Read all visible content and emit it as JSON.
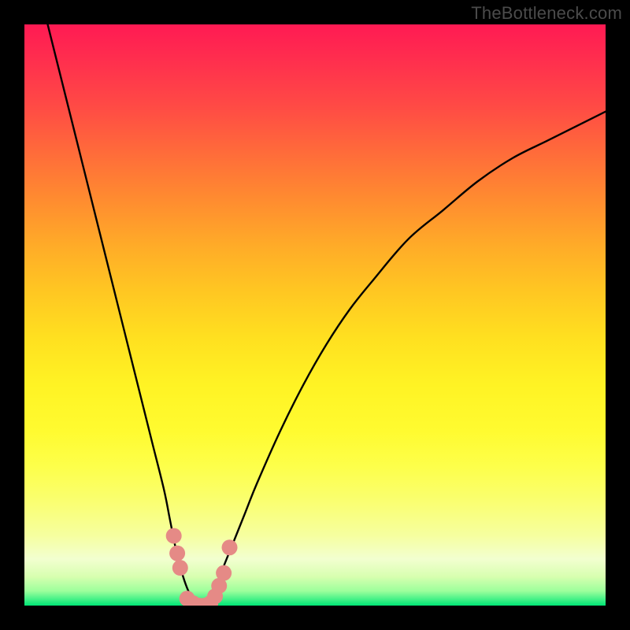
{
  "attribution": "TheBottleneck.com",
  "chart_data": {
    "type": "line",
    "title": "",
    "xlabel": "",
    "ylabel": "",
    "xlim": [
      0,
      100
    ],
    "ylim": [
      0,
      100
    ],
    "series": [
      {
        "name": "bottleneck-curve",
        "x": [
          4,
          6,
          8,
          10,
          12,
          14,
          16,
          18,
          20,
          22,
          24,
          25,
          26,
          27,
          28,
          29,
          30,
          31,
          32,
          33,
          34,
          36,
          38,
          40,
          44,
          48,
          52,
          56,
          60,
          66,
          72,
          78,
          84,
          90,
          96,
          100
        ],
        "y": [
          100,
          92,
          84,
          76,
          68,
          60,
          52,
          44,
          36,
          28,
          20,
          15,
          10,
          6,
          3,
          1,
          0,
          0,
          1,
          3,
          6,
          11,
          16,
          21,
          30,
          38,
          45,
          51,
          56,
          63,
          68,
          73,
          77,
          80,
          83,
          85
        ]
      }
    ],
    "markers": {
      "name": "highlight-dots",
      "x": [
        25.7,
        26.3,
        26.8,
        28.0,
        29.0,
        30.0,
        31.0,
        32.0,
        32.8,
        33.5,
        34.3,
        35.3
      ],
      "y": [
        12.0,
        9.0,
        6.5,
        1.2,
        0.4,
        0.0,
        0.0,
        0.4,
        1.6,
        3.4,
        5.6,
        10.0
      ],
      "color": "#e58a86",
      "radius_px": 10
    },
    "background": {
      "type": "vertical-gradient",
      "stops": [
        {
          "pos": 0.0,
          "color": "#ff1a53"
        },
        {
          "pos": 0.5,
          "color": "#ffe020"
        },
        {
          "pos": 0.92,
          "color": "#f2ffd0"
        },
        {
          "pos": 1.0,
          "color": "#00e676"
        }
      ]
    }
  }
}
